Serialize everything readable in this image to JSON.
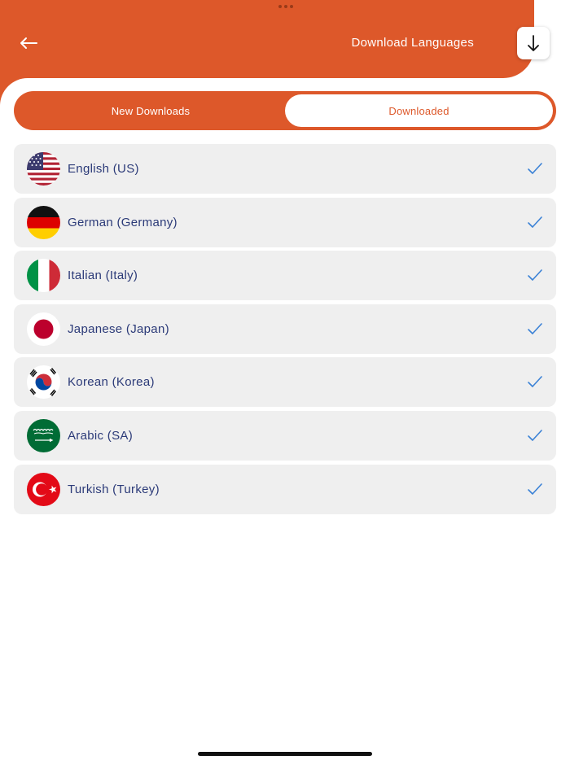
{
  "header": {
    "title": "Download Languages",
    "back_icon": "arrow-left-icon",
    "download_icon": "arrow-down-icon",
    "color": "#DD582A"
  },
  "tabs": [
    {
      "label": "New Downloads",
      "selected": false
    },
    {
      "label": "Downloaded",
      "selected": true
    }
  ],
  "languages": [
    {
      "label": "English (US)",
      "flag": "us-flag-icon",
      "downloaded": true
    },
    {
      "label": "German (Germany)",
      "flag": "germany-flag-icon",
      "downloaded": true
    },
    {
      "label": "Italian (Italy)",
      "flag": "italy-flag-icon",
      "downloaded": true
    },
    {
      "label": "Japanese (Japan)",
      "flag": "japan-flag-icon",
      "downloaded": true
    },
    {
      "label": "Korean (Korea)",
      "flag": "korea-flag-icon",
      "downloaded": true
    },
    {
      "label": "Arabic (SA)",
      "flag": "saudi-arabia-flag-icon",
      "downloaded": true
    },
    {
      "label": "Turkish (Turkey)",
      "flag": "turkey-flag-icon",
      "downloaded": true
    }
  ],
  "colors": {
    "accent": "#DD582A",
    "text": "#2B3A78",
    "check": "#3B82D6",
    "row_bg": "#EFEFEF"
  }
}
